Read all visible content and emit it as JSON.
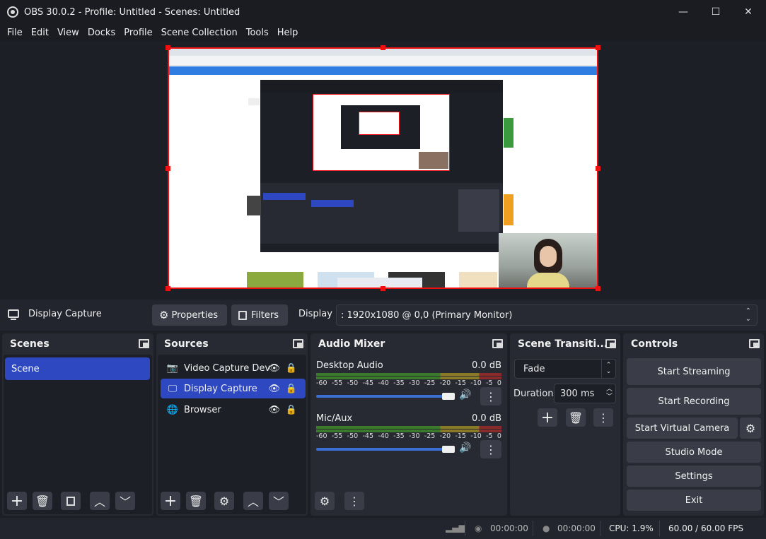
{
  "window": {
    "title": "OBS 30.0.2 - Profile: Untitled - Scenes: Untitled",
    "minimize": "—",
    "maximize": "☐",
    "close": "✕"
  },
  "menu": [
    "File",
    "Edit",
    "View",
    "Docks",
    "Profile",
    "Scene Collection",
    "Tools",
    "Help"
  ],
  "source_toolbar": {
    "source_name": "Display Capture",
    "properties_label": "Properties",
    "filters_label": "Filters",
    "display_label": "Display",
    "display_value": ": 1920x1080 @ 0,0 (Primary Monitor)"
  },
  "scenes": {
    "title": "Scenes",
    "items": [
      "Scene"
    ]
  },
  "sources": {
    "title": "Sources",
    "items": [
      {
        "label": "Video Capture Dev",
        "icon": "camera-icon",
        "selected": false
      },
      {
        "label": "Display Capture",
        "icon": "monitor-icon",
        "selected": true
      },
      {
        "label": "Browser",
        "icon": "globe-icon",
        "selected": false
      }
    ]
  },
  "audio_mixer": {
    "title": "Audio Mixer",
    "ticks": [
      "-60",
      "-55",
      "-50",
      "-45",
      "-40",
      "-35",
      "-30",
      "-25",
      "-20",
      "-15",
      "-10",
      "-5",
      "0"
    ],
    "channels": [
      {
        "name": "Desktop Audio",
        "db": "0.0 dB",
        "volume": 1.0
      },
      {
        "name": "Mic/Aux",
        "db": "0.0 dB",
        "volume": 1.0
      }
    ]
  },
  "transitions": {
    "title": "Scene Transiti...",
    "type": "Fade",
    "duration_label": "Duration",
    "duration_value": "300 ms"
  },
  "controls": {
    "title": "Controls",
    "start_streaming": "Start Streaming",
    "start_recording": "Start Recording",
    "start_virtual_camera": "Start Virtual Camera",
    "studio_mode": "Studio Mode",
    "settings": "Settings",
    "exit": "Exit"
  },
  "status": {
    "stream_time": "00:00:00",
    "record_time": "00:00:00",
    "cpu": "CPU: 1.9%",
    "fps": "60.00 / 60.00 FPS"
  },
  "colors": {
    "accent": "#2d48c0",
    "selection_red": "#ee1111",
    "panel": "#272a33",
    "background": "#1d1f26"
  }
}
